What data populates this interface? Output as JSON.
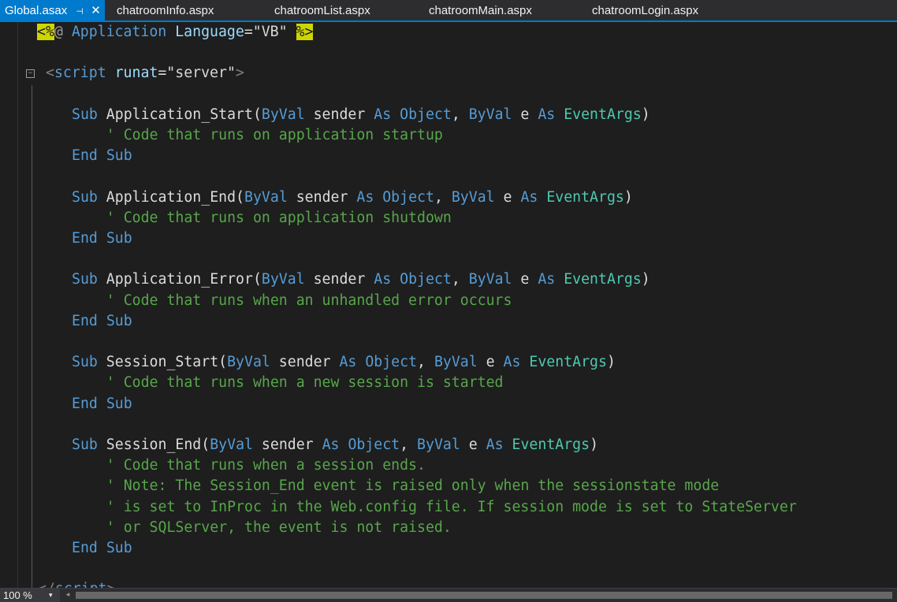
{
  "tabs": [
    {
      "label": "Global.asax",
      "active": true
    },
    {
      "label": "chatroomInfo.aspx",
      "active": false
    },
    {
      "label": "chatroomList.aspx",
      "active": false
    },
    {
      "label": "chatroomMain.aspx",
      "active": false
    },
    {
      "label": "chatroomLogin.aspx",
      "active": false
    }
  ],
  "icons": {
    "pin": "pin-icon",
    "close": "close-icon",
    "collapse": "collapse-minus-icon",
    "zoom_caret": "chevron-down-icon",
    "scroll_left": "chevron-left-icon"
  },
  "editor": {
    "collapse_glyph": "−",
    "lines": [
      {
        "spans": [
          {
            "t": "<%",
            "c": "hl-yellow"
          },
          {
            "t": "@ ",
            "c": "c-dir"
          },
          {
            "t": "Application",
            "c": "c-kw"
          },
          {
            "t": " ",
            "c": "c-plain"
          },
          {
            "t": "Language",
            "c": "c-tag"
          },
          {
            "t": "=\"VB\" ",
            "c": "c-str"
          },
          {
            "t": "%>",
            "c": "hl-yellow"
          }
        ]
      },
      {
        "spans": []
      },
      {
        "spans": [
          {
            "t": "<",
            "c": "c-gray"
          },
          {
            "t": "script",
            "c": "c-kw"
          },
          {
            "t": " ",
            "c": "c-plain"
          },
          {
            "t": "runat",
            "c": "c-tag"
          },
          {
            "t": "=\"server\"",
            "c": "c-str"
          },
          {
            "t": ">",
            "c": "c-gray"
          }
        ]
      },
      {
        "spans": []
      },
      {
        "spans": [
          {
            "t": "Sub",
            "c": "c-kw"
          },
          {
            "t": " Application_Start(",
            "c": "c-plain"
          },
          {
            "t": "ByVal",
            "c": "c-kw"
          },
          {
            "t": " sender ",
            "c": "c-plain"
          },
          {
            "t": "As",
            "c": "c-kw"
          },
          {
            "t": " ",
            "c": "c-plain"
          },
          {
            "t": "Object",
            "c": "c-kw"
          },
          {
            "t": ", ",
            "c": "c-plain"
          },
          {
            "t": "ByVal",
            "c": "c-kw"
          },
          {
            "t": " e ",
            "c": "c-plain"
          },
          {
            "t": "As",
            "c": "c-kw"
          },
          {
            "t": " ",
            "c": "c-plain"
          },
          {
            "t": "EventArgs",
            "c": "c-type"
          },
          {
            "t": ")",
            "c": "c-plain"
          }
        ]
      },
      {
        "spans": [
          {
            "t": "    ' Code that runs on application startup",
            "c": "c-cmt"
          }
        ]
      },
      {
        "spans": [
          {
            "t": "End",
            "c": "c-kw"
          },
          {
            "t": " ",
            "c": "c-plain"
          },
          {
            "t": "Sub",
            "c": "c-kw"
          }
        ]
      },
      {
        "spans": []
      },
      {
        "spans": [
          {
            "t": "Sub",
            "c": "c-kw"
          },
          {
            "t": " Application_End(",
            "c": "c-plain"
          },
          {
            "t": "ByVal",
            "c": "c-kw"
          },
          {
            "t": " sender ",
            "c": "c-plain"
          },
          {
            "t": "As",
            "c": "c-kw"
          },
          {
            "t": " ",
            "c": "c-plain"
          },
          {
            "t": "Object",
            "c": "c-kw"
          },
          {
            "t": ", ",
            "c": "c-plain"
          },
          {
            "t": "ByVal",
            "c": "c-kw"
          },
          {
            "t": " e ",
            "c": "c-plain"
          },
          {
            "t": "As",
            "c": "c-kw"
          },
          {
            "t": " ",
            "c": "c-plain"
          },
          {
            "t": "EventArgs",
            "c": "c-type"
          },
          {
            "t": ")",
            "c": "c-plain"
          }
        ]
      },
      {
        "spans": [
          {
            "t": "    ' Code that runs on application shutdown",
            "c": "c-cmt"
          }
        ]
      },
      {
        "spans": [
          {
            "t": "End",
            "c": "c-kw"
          },
          {
            "t": " ",
            "c": "c-plain"
          },
          {
            "t": "Sub",
            "c": "c-kw"
          }
        ]
      },
      {
        "spans": []
      },
      {
        "spans": [
          {
            "t": "Sub",
            "c": "c-kw"
          },
          {
            "t": " Application_Error(",
            "c": "c-plain"
          },
          {
            "t": "ByVal",
            "c": "c-kw"
          },
          {
            "t": " sender ",
            "c": "c-plain"
          },
          {
            "t": "As",
            "c": "c-kw"
          },
          {
            "t": " ",
            "c": "c-plain"
          },
          {
            "t": "Object",
            "c": "c-kw"
          },
          {
            "t": ", ",
            "c": "c-plain"
          },
          {
            "t": "ByVal",
            "c": "c-kw"
          },
          {
            "t": " e ",
            "c": "c-plain"
          },
          {
            "t": "As",
            "c": "c-kw"
          },
          {
            "t": " ",
            "c": "c-plain"
          },
          {
            "t": "EventArgs",
            "c": "c-type"
          },
          {
            "t": ")",
            "c": "c-plain"
          }
        ]
      },
      {
        "spans": [
          {
            "t": "    ' Code that runs when an unhandled error occurs",
            "c": "c-cmt"
          }
        ]
      },
      {
        "spans": [
          {
            "t": "End",
            "c": "c-kw"
          },
          {
            "t": " ",
            "c": "c-plain"
          },
          {
            "t": "Sub",
            "c": "c-kw"
          }
        ]
      },
      {
        "spans": []
      },
      {
        "spans": [
          {
            "t": "Sub",
            "c": "c-kw"
          },
          {
            "t": " Session_Start(",
            "c": "c-plain"
          },
          {
            "t": "ByVal",
            "c": "c-kw"
          },
          {
            "t": " sender ",
            "c": "c-plain"
          },
          {
            "t": "As",
            "c": "c-kw"
          },
          {
            "t": " ",
            "c": "c-plain"
          },
          {
            "t": "Object",
            "c": "c-kw"
          },
          {
            "t": ", ",
            "c": "c-plain"
          },
          {
            "t": "ByVal",
            "c": "c-kw"
          },
          {
            "t": " e ",
            "c": "c-plain"
          },
          {
            "t": "As",
            "c": "c-kw"
          },
          {
            "t": " ",
            "c": "c-plain"
          },
          {
            "t": "EventArgs",
            "c": "c-type"
          },
          {
            "t": ")",
            "c": "c-plain"
          }
        ]
      },
      {
        "spans": [
          {
            "t": "    ' Code that runs when a new session is started",
            "c": "c-cmt"
          }
        ]
      },
      {
        "spans": [
          {
            "t": "End",
            "c": "c-kw"
          },
          {
            "t": " ",
            "c": "c-plain"
          },
          {
            "t": "Sub",
            "c": "c-kw"
          }
        ]
      },
      {
        "spans": []
      },
      {
        "spans": [
          {
            "t": "Sub",
            "c": "c-kw"
          },
          {
            "t": " Session_End(",
            "c": "c-plain"
          },
          {
            "t": "ByVal",
            "c": "c-kw"
          },
          {
            "t": " sender ",
            "c": "c-plain"
          },
          {
            "t": "As",
            "c": "c-kw"
          },
          {
            "t": " ",
            "c": "c-plain"
          },
          {
            "t": "Object",
            "c": "c-kw"
          },
          {
            "t": ", ",
            "c": "c-plain"
          },
          {
            "t": "ByVal",
            "c": "c-kw"
          },
          {
            "t": " e ",
            "c": "c-plain"
          },
          {
            "t": "As",
            "c": "c-kw"
          },
          {
            "t": " ",
            "c": "c-plain"
          },
          {
            "t": "EventArgs",
            "c": "c-type"
          },
          {
            "t": ")",
            "c": "c-plain"
          }
        ]
      },
      {
        "spans": [
          {
            "t": "    ' Code that runs when a session ends.",
            "c": "c-cmt"
          }
        ]
      },
      {
        "spans": [
          {
            "t": "    ' Note: The Session_End event is raised only when the sessionstate mode",
            "c": "c-cmt"
          }
        ]
      },
      {
        "spans": [
          {
            "t": "    ' is set to InProc in the Web.config file. If session mode is set to StateServer",
            "c": "c-cmt"
          }
        ]
      },
      {
        "spans": [
          {
            "t": "    ' or SQLServer, the event is not raised.",
            "c": "c-cmt"
          }
        ]
      },
      {
        "spans": [
          {
            "t": "End",
            "c": "c-kw"
          },
          {
            "t": " ",
            "c": "c-plain"
          },
          {
            "t": "Sub",
            "c": "c-kw"
          }
        ]
      },
      {
        "spans": []
      },
      {
        "spans": [
          {
            "t": "</",
            "c": "c-gray"
          },
          {
            "t": "script",
            "c": "c-kw"
          },
          {
            "t": ">",
            "c": "c-gray"
          }
        ]
      }
    ]
  },
  "status": {
    "zoom": "100 %",
    "zoom_caret": "▾",
    "scroll_left_glyph": "◂"
  }
}
